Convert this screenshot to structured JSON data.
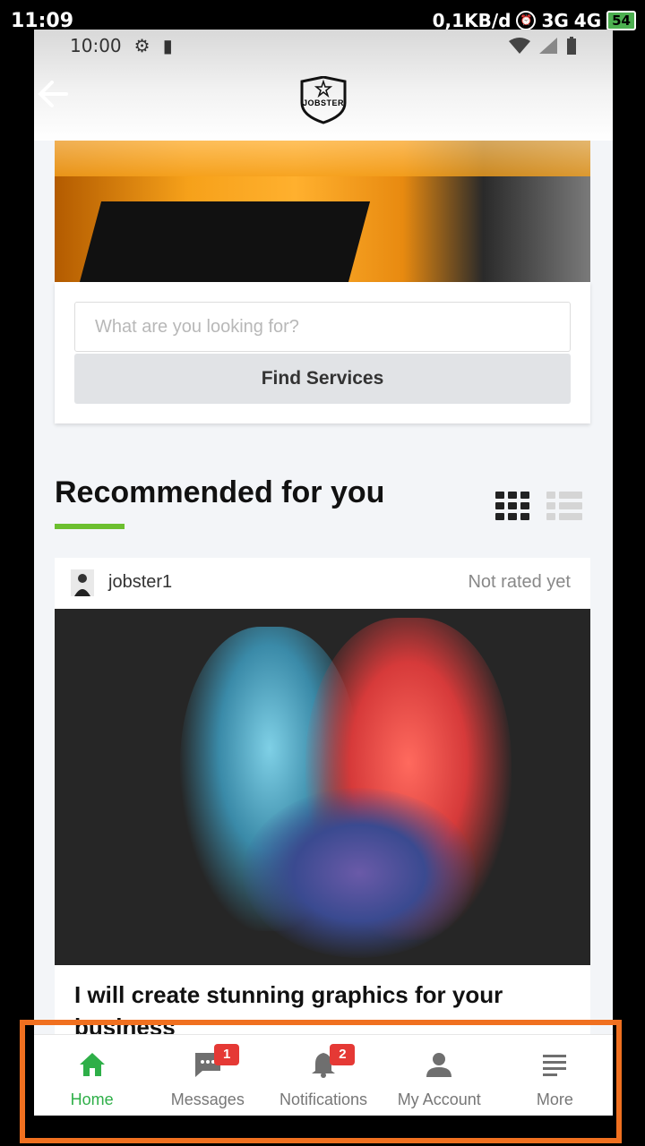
{
  "device_status": {
    "time": "11:09",
    "network_speed": "0,1KB/d",
    "sim1": "3G",
    "sim2": "4G",
    "battery": "54"
  },
  "inner_status": {
    "time": "10:00"
  },
  "header": {
    "logo_text": "JOBSTER"
  },
  "search": {
    "placeholder": "What are you looking for?",
    "button_label": "Find Services"
  },
  "recommended": {
    "title": "Recommended for you",
    "listing": {
      "seller": "jobster1",
      "rating": "Not rated yet",
      "title": "I will create stunning graphics for your business"
    }
  },
  "bottom_nav": {
    "items": [
      {
        "label": "Home",
        "icon": "home-icon",
        "active": true
      },
      {
        "label": "Messages",
        "icon": "chat-icon",
        "badge": "1"
      },
      {
        "label": "Notifications",
        "icon": "bell-icon",
        "badge": "2"
      },
      {
        "label": "My Account",
        "icon": "person-icon"
      },
      {
        "label": "More",
        "icon": "menu-icon"
      }
    ]
  },
  "colors": {
    "accent_green": "#2eaf48",
    "underline_green": "#6cbf2f",
    "badge_red": "#e53935",
    "highlight_orange": "#f07020"
  }
}
